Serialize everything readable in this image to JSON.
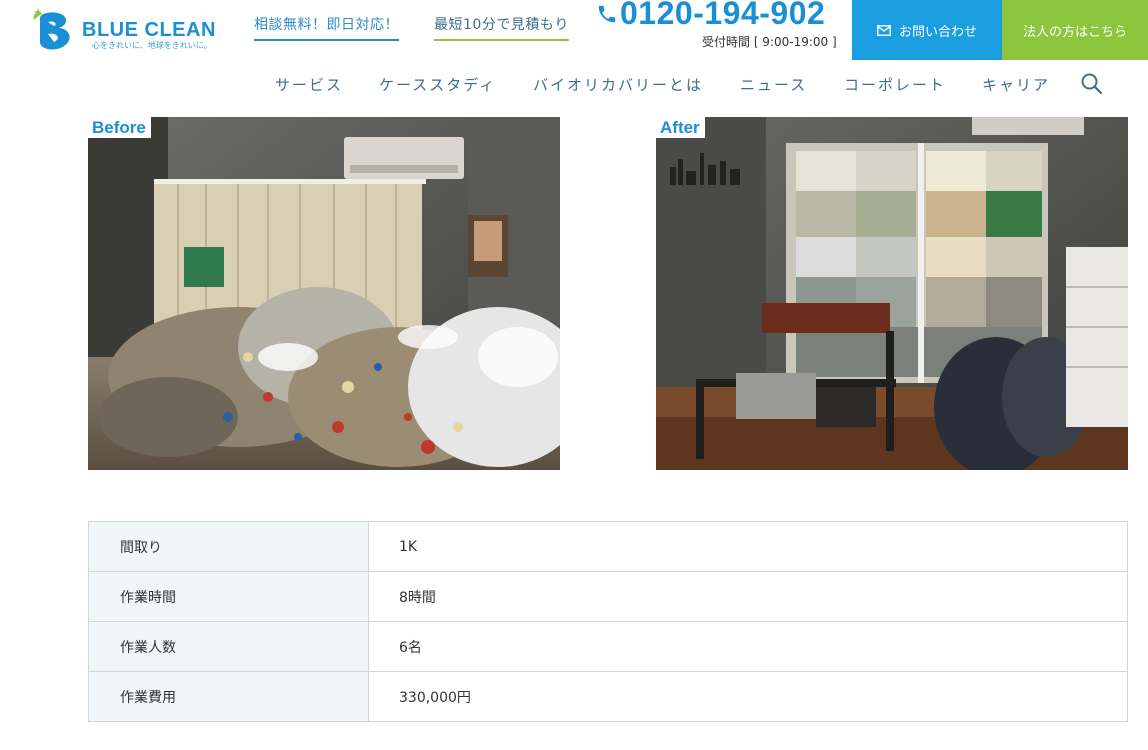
{
  "header": {
    "logo_name": "BLUE CLEAN",
    "logo_tagline": "心をきれいに、地球をきれいに。",
    "tagline_1": "相談無料！即日対応！",
    "tagline_2": "最短10分で見積もり",
    "phone": "0120-194-902",
    "hours": "受付時間 [ 9:00-19:00 ]",
    "contact_label": "お問い合わせ",
    "corporate_label": "法人の方はこちら"
  },
  "nav": {
    "items": [
      "サービス",
      "ケーススタディ",
      "バイオリカバリーとは",
      "ニュース",
      "コーポレート",
      "キャリア"
    ]
  },
  "photos": {
    "before_label": "Before",
    "after_label": "After"
  },
  "details": {
    "rows": [
      {
        "label": "間取り",
        "value": "1K"
      },
      {
        "label": "作業時間",
        "value": "8時間"
      },
      {
        "label": "作業人数",
        "value": "6名"
      },
      {
        "label": "作業費用",
        "value": "330,000円"
      }
    ]
  },
  "colors": {
    "brand_blue": "#1a8fd6",
    "contact_bg": "#1a9ee0",
    "corporate_bg": "#8cc63f",
    "nav_text": "#3d6e93"
  }
}
